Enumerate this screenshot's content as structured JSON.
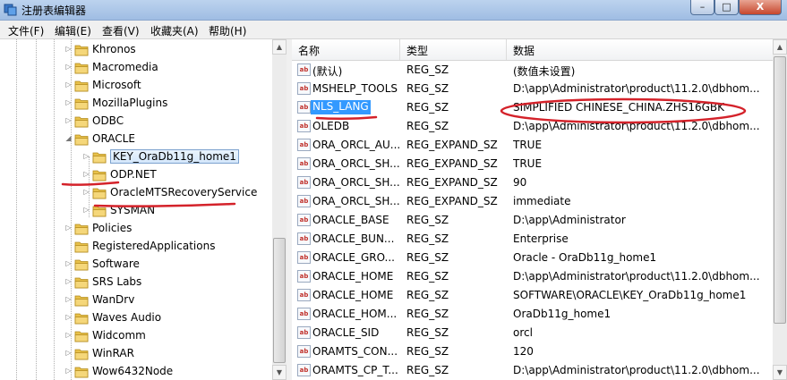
{
  "window": {
    "title": "注册表编辑器",
    "min": "–",
    "max": "□",
    "close": "X"
  },
  "menu": [
    "文件(F)",
    "编辑(E)",
    "查看(V)",
    "收藏夹(A)",
    "帮助(H)"
  ],
  "tree": {
    "items": [
      {
        "label": "Khronos",
        "level": 0,
        "expander": "closed"
      },
      {
        "label": "Macromedia",
        "level": 0,
        "expander": "closed"
      },
      {
        "label": "Microsoft",
        "level": 0,
        "expander": "closed"
      },
      {
        "label": "MozillaPlugins",
        "level": 0,
        "expander": "closed"
      },
      {
        "label": "ODBC",
        "level": 0,
        "expander": "closed"
      },
      {
        "label": "ORACLE",
        "level": 0,
        "expander": "open"
      },
      {
        "label": "KEY_OraDb11g_home1",
        "level": 1,
        "expander": "closed",
        "selected": true
      },
      {
        "label": "ODP.NET",
        "level": 1,
        "expander": "closed"
      },
      {
        "label": "OracleMTSRecoveryService",
        "level": 1,
        "expander": "closed"
      },
      {
        "label": "SYSMAN",
        "level": 1,
        "expander": "closed"
      },
      {
        "label": "Policies",
        "level": 0,
        "expander": "closed"
      },
      {
        "label": "RegisteredApplications",
        "level": 0,
        "expander": "none"
      },
      {
        "label": "Software",
        "level": 0,
        "expander": "closed"
      },
      {
        "label": "SRS Labs",
        "level": 0,
        "expander": "closed"
      },
      {
        "label": "WanDrv",
        "level": 0,
        "expander": "closed"
      },
      {
        "label": "Waves Audio",
        "level": 0,
        "expander": "closed"
      },
      {
        "label": "Widcomm",
        "level": 0,
        "expander": "closed"
      },
      {
        "label": "WinRAR",
        "level": 0,
        "expander": "closed"
      },
      {
        "label": "Wow6432Node",
        "level": 0,
        "expander": "closed"
      }
    ]
  },
  "list": {
    "columns": {
      "name": "名称",
      "type": "类型",
      "data": "数据"
    },
    "icon_text": "ab",
    "rows": [
      {
        "name": "(默认)",
        "type": "REG_SZ",
        "data": "(数值未设置)"
      },
      {
        "name": "MSHELP_TOOLS",
        "type": "REG_SZ",
        "data": "D:\\app\\Administrator\\product\\11.2.0\\dbhom..."
      },
      {
        "name": "NLS_LANG",
        "type": "REG_SZ",
        "data": "SIMPLIFIED CHINESE_CHINA.ZHS16GBK",
        "selected": true
      },
      {
        "name": "OLEDB",
        "type": "REG_SZ",
        "data": "D:\\app\\Administrator\\product\\11.2.0\\dbhom..."
      },
      {
        "name": "ORA_ORCL_AU...",
        "type": "REG_EXPAND_SZ",
        "data": "TRUE"
      },
      {
        "name": "ORA_ORCL_SH...",
        "type": "REG_EXPAND_SZ",
        "data": "TRUE"
      },
      {
        "name": "ORA_ORCL_SH...",
        "type": "REG_EXPAND_SZ",
        "data": "90"
      },
      {
        "name": "ORA_ORCL_SH...",
        "type": "REG_EXPAND_SZ",
        "data": "immediate"
      },
      {
        "name": "ORACLE_BASE",
        "type": "REG_SZ",
        "data": "D:\\app\\Administrator"
      },
      {
        "name": "ORACLE_BUN...",
        "type": "REG_SZ",
        "data": "Enterprise"
      },
      {
        "name": "ORACLE_GRO...",
        "type": "REG_SZ",
        "data": "Oracle - OraDb11g_home1"
      },
      {
        "name": "ORACLE_HOME",
        "type": "REG_SZ",
        "data": "D:\\app\\Administrator\\product\\11.2.0\\dbhom..."
      },
      {
        "name": "ORACLE_HOME",
        "type": "REG_SZ",
        "data": "SOFTWARE\\ORACLE\\KEY_OraDb11g_home1"
      },
      {
        "name": "ORACLE_HOM...",
        "type": "REG_SZ",
        "data": "OraDb11g_home1"
      },
      {
        "name": "ORACLE_SID",
        "type": "REG_SZ",
        "data": "orcl"
      },
      {
        "name": "ORAMTS_CON...",
        "type": "REG_SZ",
        "data": "120"
      },
      {
        "name": "ORAMTS_CP_T...",
        "type": "REG_SZ",
        "data": "D:\\app\\Administrator\\product\\11.2.0\\dbhom..."
      }
    ]
  },
  "colors": {
    "annotation": "#d4222a",
    "selection": "#3399ff",
    "folder": "#e8c14a"
  }
}
